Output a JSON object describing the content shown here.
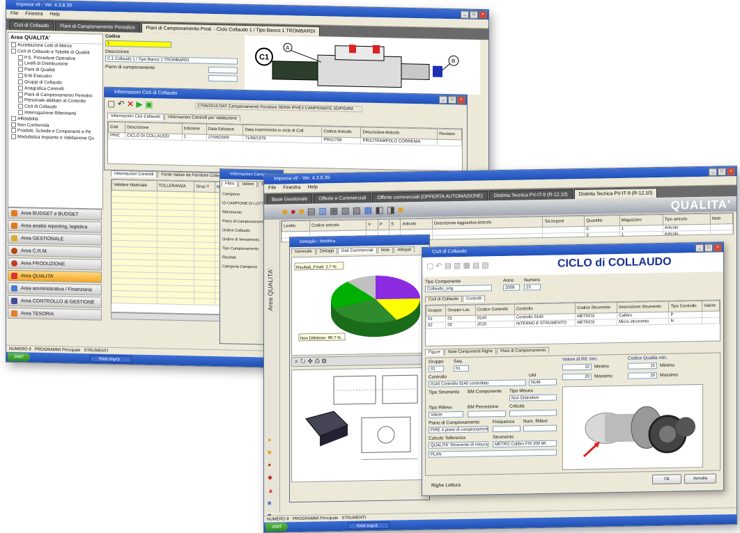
{
  "back_window": {
    "title": "Impresa v9 - Ver. 4.3.8.39",
    "menu": [
      "File",
      "Finestra",
      "Help"
    ],
    "tabs": [
      "Cicli di Collaudo",
      "Piani di Campionamento Periodico",
      "Piani di Campionamento Prod. - Ciclo Collaudo 1 / Tipo Banco 1 TROMBARDI"
    ],
    "area_title": "Area QUALITA'",
    "tree": [
      "Accettazione Lotti di Merce",
      "Cicli di Collaudo e Tabelle di Qualità",
      "P.S. Procedure Operative",
      "Livelli di Distribuzione",
      "Piani di Qualità",
      "Enti Esecutivi",
      "Gruppi di Collaudo",
      "Anagrafica Controlli",
      "Piani di Campionamento Periodici",
      "Personale abilitato al Controllo",
      "Cicli di Collaudo",
      "Interrogazione Riferimenti",
      "Affidabilità",
      "Non Conformità",
      "Prodotti, Schede e Componenti e Pe",
      "Modulistica Impianto e Validazione Qu"
    ],
    "nav_buttons": [
      "Area BUDGET e BUDGET",
      "Area analisi reporting, logistica",
      "Area GESTIONALE",
      "Area C.R.M.",
      "Area PRODUZIONE",
      "Area QUALITA'",
      "Area amministrativa / Finanziaria",
      "Area CONTROLLO di GESTIONE",
      "Area TESORIA"
    ],
    "code_label": "Codice",
    "code_value": "1",
    "description_label": "Descrizione",
    "description_value": "C.1 Collaudo 1 / Tipo Banco 1 TROMBARDI",
    "piano_label": "Piano di campionamento",
    "callouts": [
      "C1",
      "A",
      "B"
    ],
    "subwindow_title": "Informazioni Cicli di Collaudo",
    "subwindow_note": "27/06/2010 DAT Campionamento Fornitore SERIA IPHE3 CAMPIONATE 3D/PID/Rif",
    "subtabs": [
      "Informazioni Cicli Collaudo",
      "Informazioni Controlli per Validazione"
    ],
    "table_headers": [
      "Cod.",
      "Descrizione",
      "Edizione",
      "Data Edizione",
      "Data Inserimento in ciclo di Coll.",
      "Codice Articolo",
      "Descrizione Articolo",
      "Revision"
    ],
    "table_rows": [
      [
        "PRIC",
        "CICLO DI COLLAUDO",
        "1",
        "27/05/2009",
        "71/06/1978",
        "PRIC/758",
        "PRIC/TRAMPOLO CORRENIA"
      ]
    ],
    "lower_tabs": [
      "Informazioni Controlli",
      "Fonte Valore da Fornitore Collaudo"
    ],
    "lower_headers": [
      "Validare Materiale",
      "TOLLERANZA",
      "Grup Y",
      "N"
    ],
    "lower_rows": 18,
    "info_panel_title": "Informazioni Campi",
    "info_tabs": [
      "Filtro",
      "Valore",
      "Ricerca"
    ],
    "info_lines": [
      "Campione",
      "ID CAMPIONE DI LOTTO",
      "Riferimento",
      "Piano di Campionamento",
      "Ordine Collaudo",
      "Ordine di Versamento",
      "Tipo Campionamento",
      "Risultati",
      "Categoria Campione"
    ],
    "status": [
      "NUMERO 8",
      "PROGRAMMI Principale",
      "STRUMENTI"
    ],
    "task_item": "RAN Impr3"
  },
  "front_window": {
    "title": "Impresa v9 - Ver. 4.3.8.39",
    "menu": [
      "File",
      "Finestra",
      "Help"
    ],
    "tabs": [
      "Base Gestionale",
      "Offerte e Commerciali",
      "Offerte commerciali (OFFERTA AUTOMAZIONE)",
      "Distinta Tecnica PV-IT-9 (R-12.10)",
      "Distinta Tecnica PV-IT-9 (R-12.10)"
    ],
    "brand": "QUALITA'",
    "area_vertical": "Area QUALITA'",
    "list_headers": [
      "Livello",
      "Codice articolo",
      "V",
      "P",
      "S",
      "Articolo",
      "Descrizione Aggiuntiva Articolo",
      "Tot.Importi",
      "Quantità",
      "Magazzino",
      "Tipo articolo",
      "Note"
    ],
    "list_rows": [
      [
        "",
        "",
        "",
        "",
        "",
        "",
        "",
        "",
        "0",
        "1",
        "Articolo",
        ""
      ],
      [
        "",
        "",
        "",
        "",
        "",
        "",
        "",
        "",
        "0",
        "1",
        "Articolo",
        ""
      ]
    ],
    "article_window_title": "Dettaglio - Modifica",
    "article_tabs": [
      "Generale",
      "Dettagli",
      "Dati Commerciali",
      "Note",
      "Allegati"
    ],
    "pie_labels": [
      "Risultati_Finali: 2.7 %",
      "Non Difettoso: 90.7 %"
    ],
    "pie_colors": [
      "#8a2be2",
      "#ffff00",
      "#2e8b2e",
      "#00b000",
      "#c0c0c0"
    ],
    "cad_label": "Disegno",
    "ciclo_window": {
      "title": "Cicli di Collaudo",
      "heading": "CICLO di COLLAUDO",
      "tipo_label": "Tipo Componente",
      "tipo_value": "Collaudo_orig",
      "anno_label": "Anno",
      "anno_value": "2009",
      "numero_label": "Numero",
      "numero_value": "23",
      "tabs": [
        "Cicli di Collaudo",
        "Controlli"
      ],
      "grid_headers": [
        "Gruppo",
        "Gruppo Lav.",
        "Codice Controllo",
        "Controllo",
        "Codice Strumento",
        "Descrizione Strumento",
        "Tipo Controllo",
        "Valore"
      ],
      "grid_rows": [
        [
          "01",
          "01",
          "0140",
          "Controllo 0140",
          "METRO3",
          "Calibro",
          "P",
          ""
        ],
        [
          "02",
          "02",
          "2010",
          "INTERNO E STRUMENTO",
          "METRO3",
          "Micro strumento",
          "N",
          ""
        ]
      ],
      "lower_tabs": [
        "Figure",
        "Note Componenti Righe",
        "Piani di Campionamento"
      ],
      "gruppo_label": "Gruppo",
      "gruppo_value": "01",
      "seq_label": "Seq.",
      "seq_value": "01",
      "controllo_label": "Controllo",
      "controllo_value": "0140 Controllo 0140 controllato",
      "um_label": "UM",
      "um_value": "NUM",
      "tipo_strumento_label": "Tipo Strumento",
      "tipo_strumento_value": "BM Componente",
      "tipo_misura_label": "Tipo Misura",
      "tipo_misura_value": "Non Distruttivo",
      "valore_min_label": "Valore di Rif. min.",
      "valore_min_value": "15",
      "valore_max_label": "Codice Qualità min.",
      "valore_max_value": "15",
      "min_label": "Minimo",
      "max_label": "Massimo",
      "dx1": "20",
      "dx2": "20",
      "fields": [
        "Tipo Rilievo",
        "BM Percezione",
        "Criticità",
        "Piano di Campionamento",
        "Frequenza",
        "Num. Rilievi",
        "Calcolo Tolleranza",
        "Strumento"
      ],
      "field_values": [
        "Valore",
        "PIRE 4 piano di campionamento",
        "QUALITA' Strumento di misura",
        "METRO Calibro FIS 200 MI",
        "PLAN"
      ],
      "btn_ok": "Ok",
      "btn_cancel": "Annulla"
    },
    "footer_label": "Righe",
    "footer_value": "Lettura",
    "status": [
      "NUMERO 8",
      "PROGRAMMI Principale",
      "STRUMENTI"
    ],
    "task_item": "RAN Impr3"
  },
  "colors": {
    "titlebar": "#2d5fc4",
    "highlight": "#ffff00",
    "nav_active": "#f5a623",
    "heading_blue": "#1a2f8f"
  }
}
